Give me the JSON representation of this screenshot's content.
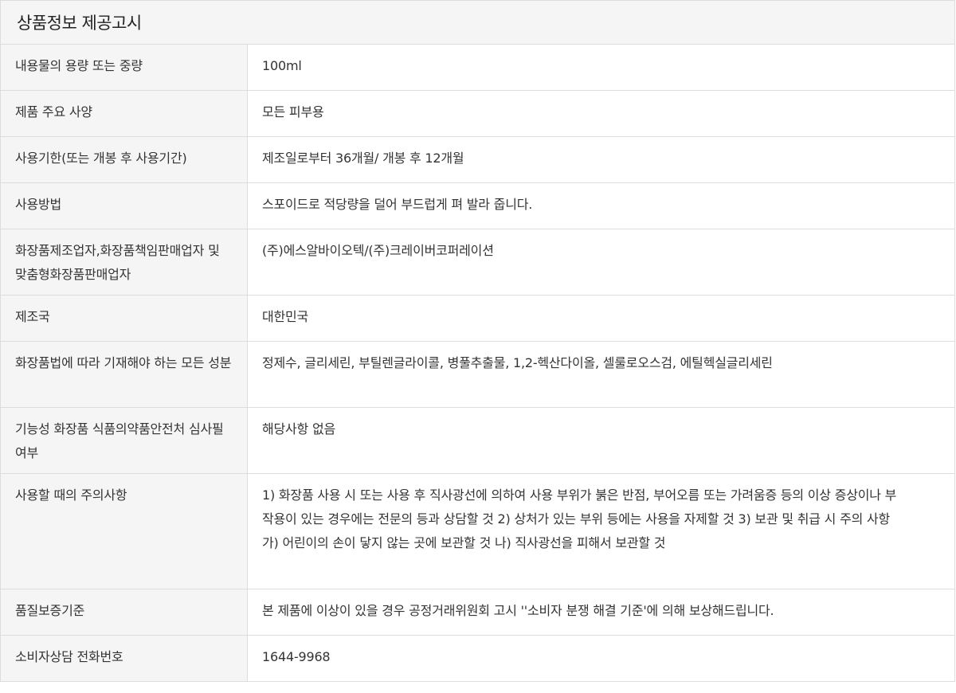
{
  "title": "상품정보 제공고시",
  "rows": [
    {
      "label": "내용물의 용량 또는 중량",
      "value": "100ml"
    },
    {
      "label": "제품 주요 사양",
      "value": "모든 피부용"
    },
    {
      "label": "사용기한(또는 개봉 후 사용기간)",
      "value": "제조일로부터 36개월/ 개봉 후 12개월"
    },
    {
      "label": "사용방법",
      "value": "스포이드로 적당량을 덜어 부드럽게 펴 발라 줍니다."
    },
    {
      "label": "화장품제조업자,화장품책임판매업자 및 맞춤형화장품판매업자",
      "value": "(주)에스알바이오텍/(주)크레이버코퍼레이션"
    },
    {
      "label": "제조국",
      "value": "대한민국"
    },
    {
      "label": "화장품법에 따라 기재해야 하는 모든 성분",
      "value": "정제수, 글리세린, 부틸렌글라이콜, 병풀추출물, 1,2-헥산다이올, 셀룰로오스검, 에틸헥실글리세린"
    },
    {
      "label": "기능성 화장품 식품의약품안전처 심사필 여부",
      "value": "해당사항 없음"
    },
    {
      "label": "사용할 때의 주의사항",
      "value": "1) 화장품 사용 시 또는 사용 후 직사광선에 의하여 사용 부위가 붉은 반점, 부어오름 또는 가려움증 등의 이상 증상이나 부작용이 있는 경우에는 전문의 등과 상담할 것 2) 상처가 있는 부위 등에는 사용을 자제할 것 3) 보관 및 취급 시 주의 사항 가) 어린이의 손이 닿지 않는 곳에 보관할 것 나) 직사광선을 피해서 보관할 것"
    },
    {
      "label": "품질보증기준",
      "value": "본 제품에 이상이 있을 경우 공정거래위원회 고시 ''소비자 분쟁 해결 기준'에 의해 보상해드립니다."
    },
    {
      "label": "소비자상담 전화번호",
      "value": "1644-9968"
    }
  ]
}
